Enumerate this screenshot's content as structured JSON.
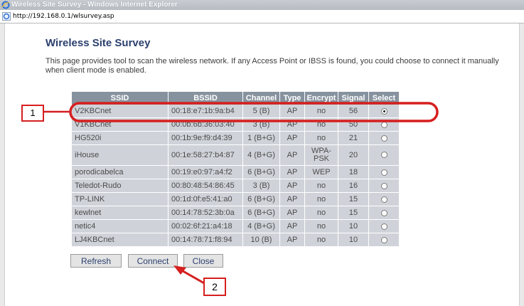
{
  "window": {
    "title": "Wireless Site Survey - Windows Internet Explorer",
    "url": "http://192.168.0.1/wlsurvey.asp"
  },
  "page": {
    "heading": "Wireless Site Survey",
    "description": "This page provides tool to scan the wireless network. If any Access Point or IBSS is found, you could choose to connect it manually when client mode is enabled."
  },
  "table": {
    "headers": [
      "SSID",
      "BSSID",
      "Channel",
      "Type",
      "Encrypt",
      "Signal",
      "Select"
    ],
    "rows": [
      {
        "ssid": "V2KBCnet",
        "bssid": "00:18:e7:1b:9a:b4",
        "channel": "5 (B)",
        "type": "AP",
        "encrypt": "no",
        "signal": "56",
        "selected": true
      },
      {
        "ssid": "V1KBCnet",
        "bssid": "00:0b:6b:36:03:40",
        "channel": "3 (B)",
        "type": "AP",
        "encrypt": "no",
        "signal": "50",
        "selected": false
      },
      {
        "ssid": "HG520i",
        "bssid": "00:1b:9e:f9:d4:39",
        "channel": "1 (B+G)",
        "type": "AP",
        "encrypt": "no",
        "signal": "21",
        "selected": false
      },
      {
        "ssid": "iHouse",
        "bssid": "00:1e:58:27:b4:87",
        "channel": "4 (B+G)",
        "type": "AP",
        "encrypt": "WPA-PSK",
        "signal": "20",
        "selected": false
      },
      {
        "ssid": "porodicabelca",
        "bssid": "00:19:e0:97:a4:f2",
        "channel": "6 (B+G)",
        "type": "AP",
        "encrypt": "WEP",
        "signal": "18",
        "selected": false
      },
      {
        "ssid": "Teledot-Rudo",
        "bssid": "00:80:48:54:86:45",
        "channel": "3 (B)",
        "type": "AP",
        "encrypt": "no",
        "signal": "16",
        "selected": false
      },
      {
        "ssid": "TP-LINK",
        "bssid": "00:1d:0f:e5:41:a0",
        "channel": "6 (B+G)",
        "type": "AP",
        "encrypt": "no",
        "signal": "15",
        "selected": false
      },
      {
        "ssid": "kewlnet",
        "bssid": "00:14:78:52:3b:0a",
        "channel": "6 (B+G)",
        "type": "AP",
        "encrypt": "no",
        "signal": "15",
        "selected": false
      },
      {
        "ssid": "netic4",
        "bssid": "00:02:6f:21:a4:18",
        "channel": "4 (B+G)",
        "type": "AP",
        "encrypt": "no",
        "signal": "10",
        "selected": false
      },
      {
        "ssid": "LJ4KBCnet",
        "bssid": "00:14:78:71:f8:94",
        "channel": "10 (B)",
        "type": "AP",
        "encrypt": "no",
        "signal": "10",
        "selected": false
      }
    ]
  },
  "buttons": {
    "refresh": "Refresh",
    "connect": "Connect",
    "close": "Close"
  },
  "annotations": {
    "callout_1": "1",
    "callout_2": "2"
  },
  "colors": {
    "annotation_red": "#d61f1f",
    "header_bg": "#87929f",
    "row_bg": "#cfd3d9",
    "heading_blue": "#2b3f6e"
  },
  "icons": {
    "browser": "ie-icon",
    "page": "page-ie-icon"
  }
}
